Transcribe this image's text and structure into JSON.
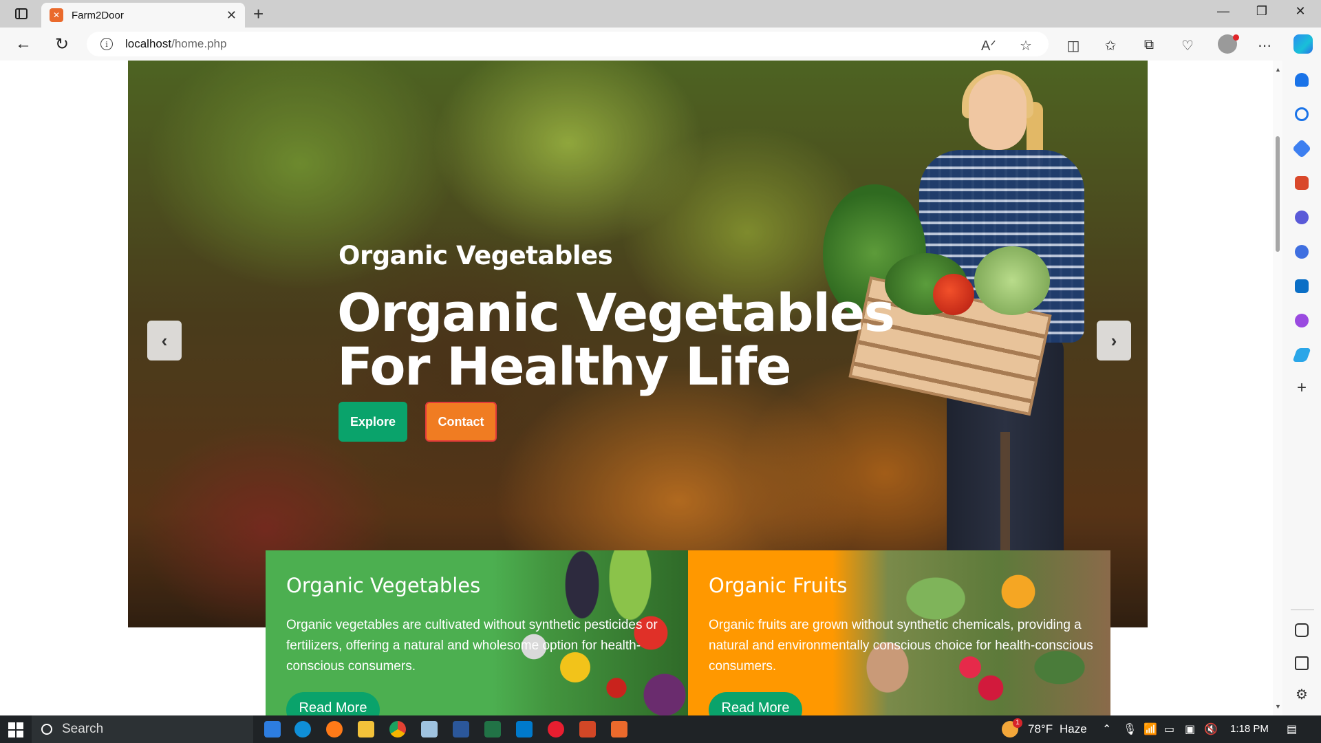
{
  "browser": {
    "tab_title": "Farm2Door",
    "tab_favicon": "xampp-icon",
    "url_host": "localhost",
    "url_path": "/home.php"
  },
  "hero": {
    "subtitle": "Organic Vegetables",
    "title": "Organic Vegetables For Healthy Life",
    "explore_label": "Explore",
    "contact_label": "Contact",
    "prev_label": "‹",
    "next_label": "›"
  },
  "cards": [
    {
      "title": "Organic Vegetables",
      "text": "Organic vegetables are cultivated without synthetic pesticides or fertilizers, offering a natural and wholesome option for health-conscious consumers.",
      "button": "Read More"
    },
    {
      "title": "Organic Fruits",
      "text": "Organic fruits are grown without synthetic chemicals, providing a natural and environmentally conscious choice for health-conscious consumers.",
      "button": "Read More"
    }
  ],
  "taskbar": {
    "search_placeholder": "Search",
    "weather": "78°F",
    "weather_desc": "Haze",
    "weather_badge": "1",
    "time": "1:18 PM"
  },
  "colors": {
    "accent_green": "#0aa36b",
    "accent_orange": "#f07c22",
    "card_green": "#4caf50",
    "card_orange": "#ff9800"
  }
}
